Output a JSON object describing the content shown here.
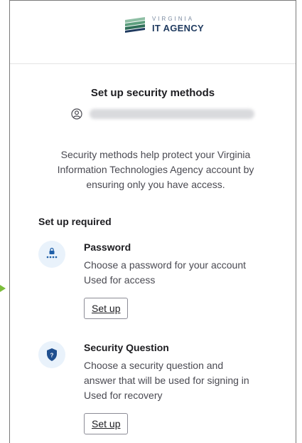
{
  "logo": {
    "small": "VIRGINIA",
    "big": "IT AGENCY"
  },
  "title": "Set up security methods",
  "user": {
    "icon": "user-icon",
    "email": "●●●●●●●●●●●●●●●●●●●●●●●●"
  },
  "description": "Security methods help protect your Virginia Information Technologies Agency account by ensuring only you have access.",
  "section_label": "Set up required",
  "methods": [
    {
      "icon": "password-icon",
      "title": "Password",
      "lines": [
        "Choose a password for your account",
        "Used for access"
      ],
      "button": "Set up"
    },
    {
      "icon": "security-question-icon",
      "title": "Security Question",
      "lines": [
        "Choose a security question and",
        "answer that will be used for signing in",
        "Used for recovery"
      ],
      "button": "Set up"
    }
  ],
  "colors": {
    "accent": "#1f5fa8",
    "icon_bg": "#e9f2fb",
    "border": "#7a7a7a",
    "arrow": "#7cbd3b"
  }
}
